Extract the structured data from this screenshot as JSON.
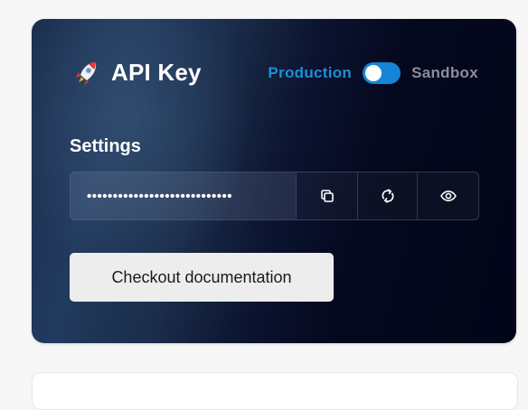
{
  "card": {
    "title": "API Key",
    "title_icon": "rocket-icon"
  },
  "environment": {
    "production_label": "Production",
    "sandbox_label": "Sandbox",
    "toggle_state": "production",
    "active_color": "#1785d6"
  },
  "settings": {
    "label": "Settings",
    "api_key_masked": "••••••••••••••••••••••••••••",
    "actions": {
      "copy_icon": "copy-icon",
      "refresh_icon": "refresh-icon",
      "reveal_icon": "eye-icon"
    }
  },
  "documentation_button": {
    "label": "Checkout documentation"
  }
}
